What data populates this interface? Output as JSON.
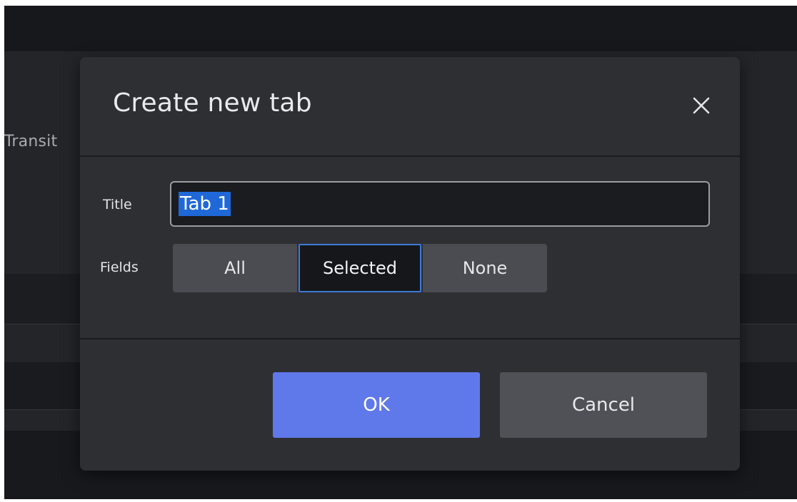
{
  "background": {
    "partial_label": "Transit"
  },
  "dialog": {
    "title": "Create new tab",
    "close_icon": "close-icon",
    "fields": {
      "title_label": "Title",
      "title_value": "Tab 1",
      "fields_label": "Fields",
      "options": [
        "All",
        "Selected",
        "None"
      ],
      "selected_option": "Selected"
    },
    "buttons": {
      "ok": "OK",
      "cancel": "Cancel"
    }
  },
  "colors": {
    "accent": "#6079ea",
    "selection": "#1f68d8",
    "selected_border": "#3d7ad9",
    "dialog_bg": "#2e2f33"
  }
}
